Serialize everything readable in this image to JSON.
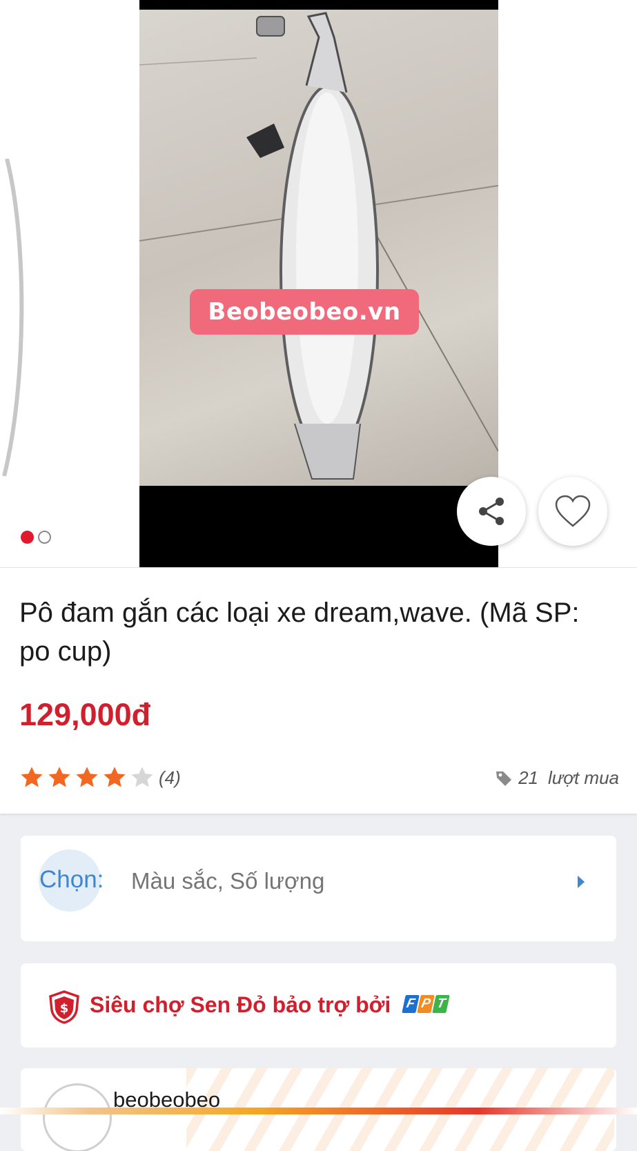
{
  "gallery": {
    "watermark": "Beobeobeo.vn",
    "slide_count": 2,
    "active_slide": 1,
    "share_icon": "share-icon",
    "favorite_icon": "heart-icon"
  },
  "product": {
    "title": "Pô đam gắn các loại xe dream,wave. (Mã SP: po cup)",
    "price": "129,000đ",
    "rating": 4,
    "rating_max": 5,
    "review_count": "(4)",
    "sold_count": "21",
    "sold_label": "lượt mua"
  },
  "options": {
    "label": "Chọn:",
    "value": "Màu sắc, Số lượng"
  },
  "trust": {
    "text": "Siêu chợ Sen Đỏ bảo trợ bởi",
    "brand_letters": [
      "F",
      "P",
      "T"
    ]
  },
  "shop": {
    "name": "beobeobeo"
  },
  "colors": {
    "price_red": "#d0202e",
    "link_blue": "#3f86d1",
    "star_orange": "#f26722",
    "star_empty": "#d6d6d6",
    "fpt_blue": "#1d6fd2",
    "fpt_orange": "#f28c22",
    "fpt_green": "#3bb54a"
  }
}
